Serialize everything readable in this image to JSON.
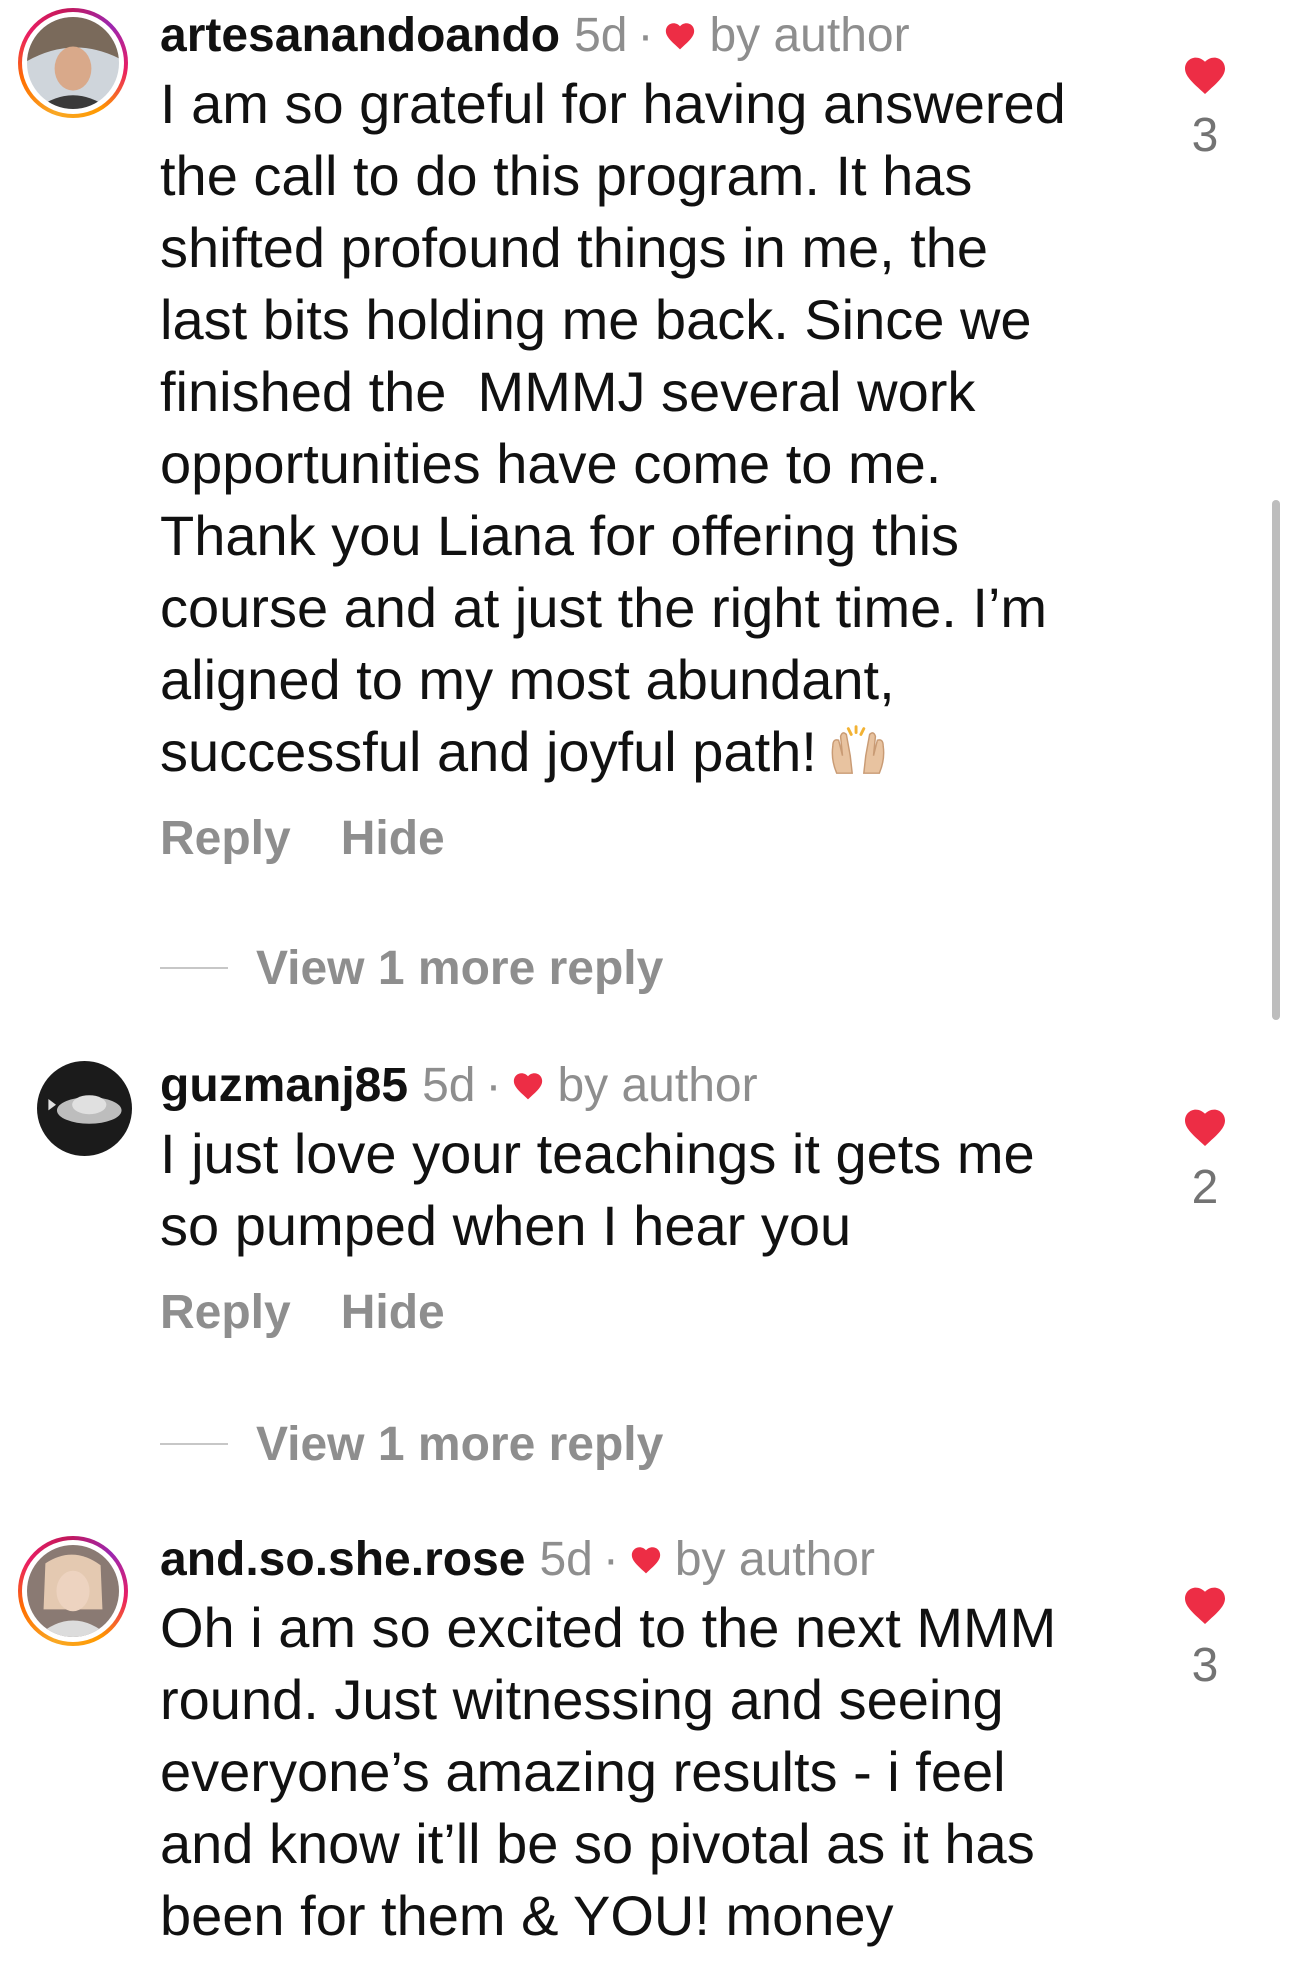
{
  "comments": [
    {
      "username": "artesanandoando",
      "time": "5d",
      "separator": "·",
      "liked_by_author": "by author",
      "text_lines": [
        "I am so grateful for having answered",
        "the call to do this program. It has",
        "shifted profound things in me, the",
        "last bits holding me back. Since we",
        "finished the  MMMJ several work",
        "opportunities have come to me.",
        "Thank you Liana for offering this",
        "course and at just the right time. I’m",
        "aligned to my most abundant,",
        "successful and joyful path!"
      ],
      "emoji": "raising-hands-emoji",
      "reply_label": "Reply",
      "hide_label": "Hide",
      "view_more": "View 1 more reply",
      "like_count": "3"
    },
    {
      "username": "guzmanj85",
      "time": "5d",
      "separator": "·",
      "liked_by_author": "by author",
      "text_lines": [
        "I just love your teachings it gets me",
        "so pumped when I hear you"
      ],
      "reply_label": "Reply",
      "hide_label": "Hide",
      "view_more": "View 1 more reply",
      "like_count": "2"
    },
    {
      "username": "and.so.she.rose",
      "time": "5d",
      "separator": "·",
      "liked_by_author": "by author",
      "text_lines": [
        "Oh i am so excited to the next MMM",
        "round. Just witnessing and seeing",
        "everyone’s amazing results - i feel",
        "and know it’ll be so pivotal as it has",
        "been for them & YOU! money"
      ],
      "like_count": "3"
    }
  ],
  "colors": {
    "heart": "#ed2d45",
    "muted": "#8e8e8e",
    "text": "#111111"
  },
  "icons": {
    "like": "heart-icon",
    "author_like": "heart-filled-icon",
    "emoji": "raising-hands-emoji"
  }
}
